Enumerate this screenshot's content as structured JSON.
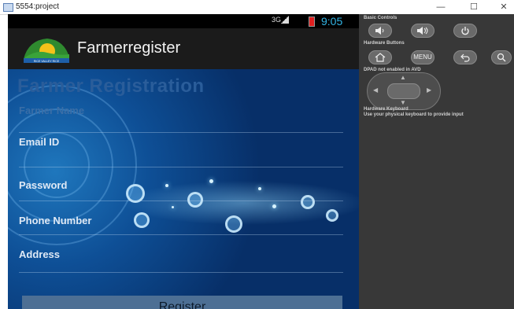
{
  "window": {
    "title": "5554:project",
    "minimize": "—",
    "maximize": "☐",
    "close": "✕"
  },
  "status_bar": {
    "network": "3G",
    "time": "9:05"
  },
  "action_bar": {
    "app_name": "Farmerregister",
    "logo_text": "RICE VALLEY RICE"
  },
  "form": {
    "heading": "Farmer Registration",
    "fields": [
      {
        "label": "Farmer Name",
        "value": ""
      },
      {
        "label": "Email ID",
        "value": ""
      },
      {
        "label": "Password",
        "value": ""
      },
      {
        "label": "Phone Number",
        "value": ""
      },
      {
        "label": "Address",
        "value": ""
      }
    ],
    "register_label": "Register"
  },
  "controls": {
    "basic_title": "Basic Controls",
    "hardware_title": "Hardware Buttons",
    "menu_label": "MENU",
    "dpad_title": "DPAD not enabled in AVD",
    "keyboard_title": "Hardware Keyboard",
    "keyboard_note": "Use your physical keyboard to provide input"
  },
  "colors": {
    "accent": "#33b5e5",
    "actionbar": "#1b1b1b",
    "background": "#07306a",
    "button": "#4d6f94"
  }
}
